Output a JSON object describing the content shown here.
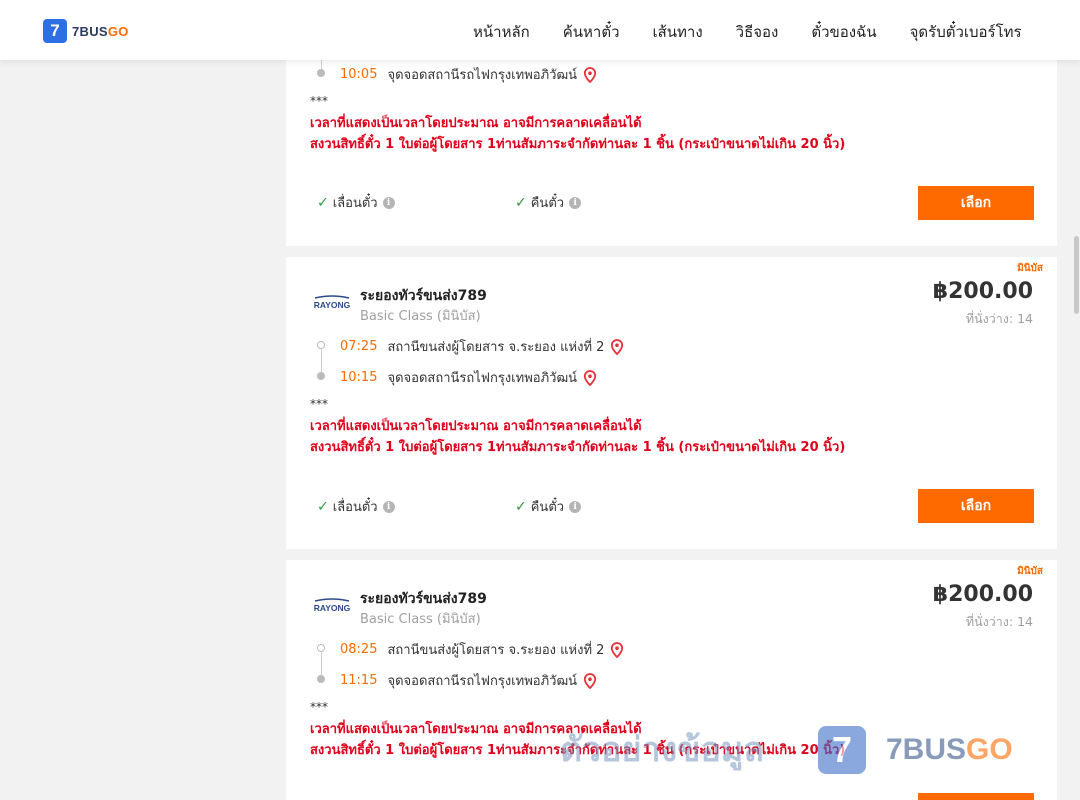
{
  "header": {
    "logo_mark": "7",
    "logo_text_main": "7BUS",
    "logo_text_accent": "GO",
    "nav": [
      {
        "label": "หน้าหลัก"
      },
      {
        "label": "ค้นหาตั๋ว"
      },
      {
        "label": "เส้นทาง"
      },
      {
        "label": "วิธีจอง"
      },
      {
        "label": "ตั๋วของฉัน"
      },
      {
        "label": "จุดรับตั๋วเบอร์โทร"
      }
    ]
  },
  "colors": {
    "accent": "#ff6a00",
    "notice": "#e0001b",
    "check": "#2e9a3a",
    "brand_blue": "#2f6fe4"
  },
  "common": {
    "asterisks": "***",
    "notice_line1": "เวลาที่แสดงเป็นเวลาโดยประมาณ อาจมีการคลาดเคลื่อนได้",
    "notice_line2": "สงวนสิทธิ์ตั๋ว 1 ใบต่อผู้โดยสาร 1ท่านสัมภาระจำกัดท่านละ 1 ชิ้น (กระเป๋าขนาดไม่เกิน 20 นิ้ว)",
    "policy_change": "เลื่อนตั๋ว",
    "policy_refund": "คืนตั๋ว",
    "select_label": "เลือก",
    "info_glyph": "i",
    "check_glyph": "✓"
  },
  "trips": [
    {
      "arrive_time": "10:05",
      "arrive_place": "จุดจอดสถานีรถไฟกรุงเทพอภิวัฒน์"
    },
    {
      "type_badge": "มินิบัส",
      "operator_logo": "RAYONG",
      "operator": "ระยองทัวร์ขนส่ง789",
      "bus_class": "Basic Class (มินิบัส)",
      "price": "฿200.00",
      "seats": "ที่นั่งว่าง: 14",
      "depart_time": "07:25",
      "depart_place": "สถานีขนส่งผู้โดยสาร จ.ระยอง แห่งที่ 2",
      "arrive_time": "10:15",
      "arrive_place": "จุดจอดสถานีรถไฟกรุงเทพอภิวัฒน์"
    },
    {
      "type_badge": "มินิบัส",
      "operator_logo": "RAYONG",
      "operator": "ระยองทัวร์ขนส่ง789",
      "bus_class": "Basic Class (มินิบัส)",
      "price": "฿200.00",
      "seats": "ที่นั่งว่าง: 14",
      "depart_time": "08:25",
      "depart_place": "สถานีขนส่งผู้โดยสาร จ.ระยอง แห่งที่ 2",
      "arrive_time": "11:15",
      "arrive_place": "จุดจอดสถานีรถไฟกรุงเทพอภิวัฒน์"
    }
  ],
  "watermark": {
    "text": "ตัวอย่างข้อมูล",
    "logo_mark": "7",
    "logo_main": "7BUS",
    "logo_accent": "GO"
  }
}
